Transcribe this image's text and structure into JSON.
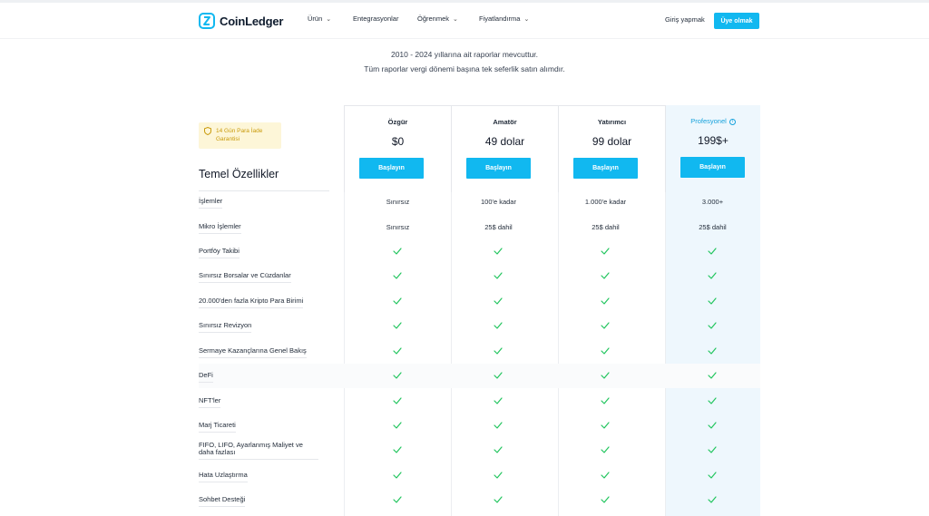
{
  "header": {
    "logo_text": "CoinLedger",
    "nav": [
      {
        "label": "Ürün",
        "dropdown": true
      },
      {
        "label": "Entegrasyonlar",
        "dropdown": false
      },
      {
        "label": "Öğrenmek",
        "dropdown": true
      },
      {
        "label": "Fiyatlandırma",
        "dropdown": true
      }
    ],
    "login_label": "Giriş yapmak",
    "signup_label": "Üye olmak"
  },
  "intro": {
    "line1": "2010 - 2024 yıllarına ait raporlar mevcuttur.",
    "line2": "Tüm raporlar vergi dönemi başına tek seferlik satın alımdır."
  },
  "badge_text": "14 Gün Para İade Garantisi",
  "features_title": "Temel Özellikler",
  "plans": [
    {
      "name": "Özgür",
      "price": "$0",
      "button": "Başlayın"
    },
    {
      "name": "Amatör",
      "price": "49 dolar",
      "button": "Başlayın"
    },
    {
      "name": "Yatırımcı",
      "price": "99 dolar",
      "button": "Başlayın"
    },
    {
      "name": "Profesyonel",
      "price": "199$+",
      "button": "Başlayın"
    }
  ],
  "features": [
    {
      "label": "İşlemler",
      "values": [
        "Sınırsız",
        "100'e kadar",
        "1.000'e kadar",
        "3.000+"
      ]
    },
    {
      "label": "Mikro İşlemler",
      "values": [
        "Sınırsız",
        "25$ dahil",
        "25$ dahil",
        "25$ dahil"
      ]
    },
    {
      "label": "Portföy Takibi",
      "values": [
        "check",
        "check",
        "check",
        "check"
      ]
    },
    {
      "label": "Sınırsız Borsalar ve Cüzdanlar",
      "values": [
        "check",
        "check",
        "check",
        "check"
      ]
    },
    {
      "label": "20.000'den fazla Kripto Para Birimi",
      "values": [
        "check",
        "check",
        "check",
        "check"
      ]
    },
    {
      "label": "Sınırsız Revizyon",
      "values": [
        "check",
        "check",
        "check",
        "check"
      ]
    },
    {
      "label": "Sermaye Kazançlarına Genel Bakış",
      "values": [
        "check",
        "check",
        "check",
        "check"
      ]
    },
    {
      "label": "DeFi",
      "values": [
        "check",
        "check",
        "check",
        "check"
      ]
    },
    {
      "label": "NFT'ler",
      "values": [
        "check",
        "check",
        "check",
        "check"
      ]
    },
    {
      "label": "Marj Ticareti",
      "values": [
        "check",
        "check",
        "check",
        "check"
      ]
    },
    {
      "label": "FIFO, LIFO, Ayarlanmış Maliyet ve daha fazlası",
      "values": [
        "check",
        "check",
        "check",
        "check"
      ]
    },
    {
      "label": "Hata Uzlaştırma",
      "values": [
        "check",
        "check",
        "check",
        "check"
      ]
    },
    {
      "label": "Sohbet Desteği",
      "values": [
        "check",
        "check",
        "check",
        "check"
      ]
    }
  ],
  "colors": {
    "accent": "#11b8f0",
    "check": "#22c55e",
    "pro_bg": "#eef7fd",
    "badge_bg": "#fdf6d8",
    "badge_text": "#c99a0a"
  }
}
